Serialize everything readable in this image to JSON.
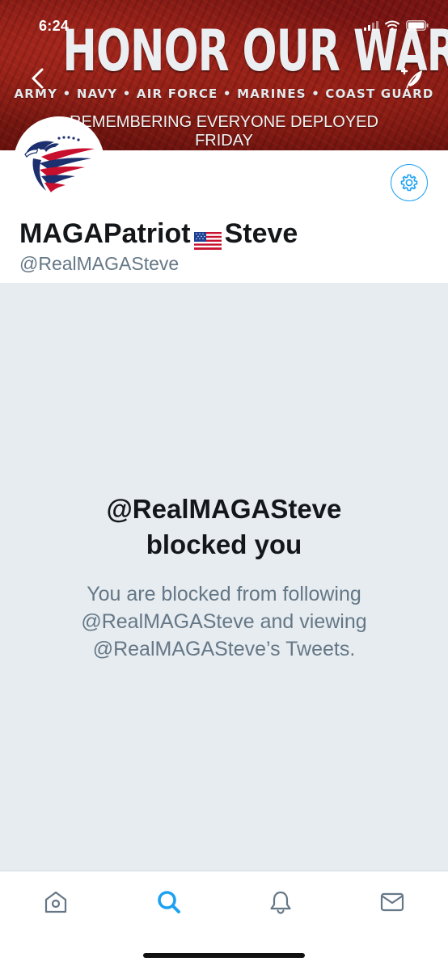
{
  "status_bar": {
    "time": "6:24"
  },
  "banner": {
    "title": "HONOR OUR WARRIORS",
    "branches": "ARMY • NAVY • AIR FORCE • MARINES • COAST GUARD",
    "remember_line1": "REMEMBERING EVERYONE  DEPLOYED",
    "remember_line2": "FRIDAY"
  },
  "profile": {
    "display_name_part1": "MAGAPatriot",
    "display_name_part2": "Steve",
    "flag_icon": "us-flag-emoji",
    "handle": "@RealMAGASteve"
  },
  "blocked": {
    "title_line1": "@RealMAGASteve",
    "title_line2": "blocked you",
    "description": "You are blocked from following @RealMAGASteve and viewing @RealMAGASteve’s Tweets."
  },
  "tabs": [
    {
      "name": "home",
      "icon": "home-icon",
      "active": false
    },
    {
      "name": "search",
      "icon": "search-icon",
      "active": true
    },
    {
      "name": "notifications",
      "icon": "bell-icon",
      "active": false
    },
    {
      "name": "messages",
      "icon": "mail-icon",
      "active": false
    }
  ],
  "colors": {
    "accent": "#1da1f2",
    "text_primary": "#14171a",
    "text_secondary": "#657786",
    "panel_bg": "#e6ecf0",
    "inactive_icon": "#657786"
  }
}
